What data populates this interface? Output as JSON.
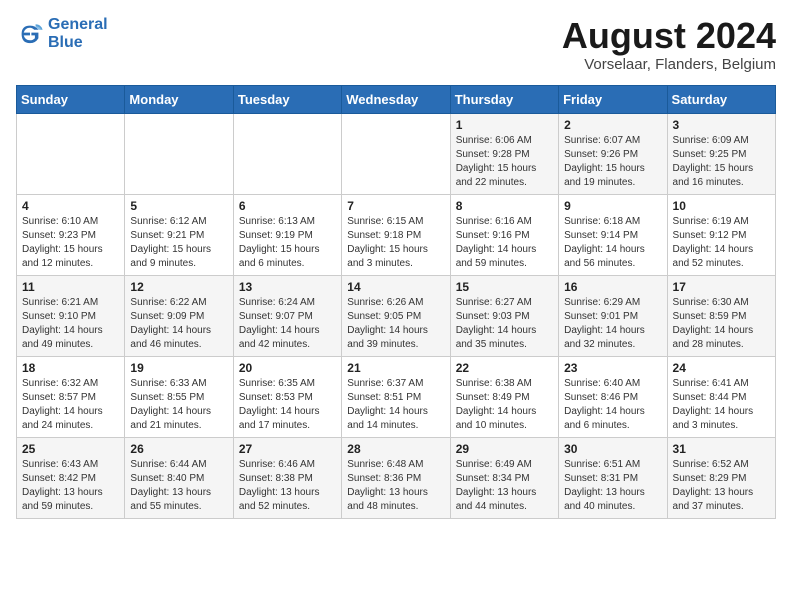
{
  "header": {
    "logo_line1": "General",
    "logo_line2": "Blue",
    "title": "August 2024",
    "subtitle": "Vorselaar, Flanders, Belgium"
  },
  "days_of_week": [
    "Sunday",
    "Monday",
    "Tuesday",
    "Wednesday",
    "Thursday",
    "Friday",
    "Saturday"
  ],
  "weeks": [
    [
      {
        "day": "",
        "info": ""
      },
      {
        "day": "",
        "info": ""
      },
      {
        "day": "",
        "info": ""
      },
      {
        "day": "",
        "info": ""
      },
      {
        "day": "1",
        "info": "Sunrise: 6:06 AM\nSunset: 9:28 PM\nDaylight: 15 hours\nand 22 minutes."
      },
      {
        "day": "2",
        "info": "Sunrise: 6:07 AM\nSunset: 9:26 PM\nDaylight: 15 hours\nand 19 minutes."
      },
      {
        "day": "3",
        "info": "Sunrise: 6:09 AM\nSunset: 9:25 PM\nDaylight: 15 hours\nand 16 minutes."
      }
    ],
    [
      {
        "day": "4",
        "info": "Sunrise: 6:10 AM\nSunset: 9:23 PM\nDaylight: 15 hours\nand 12 minutes."
      },
      {
        "day": "5",
        "info": "Sunrise: 6:12 AM\nSunset: 9:21 PM\nDaylight: 15 hours\nand 9 minutes."
      },
      {
        "day": "6",
        "info": "Sunrise: 6:13 AM\nSunset: 9:19 PM\nDaylight: 15 hours\nand 6 minutes."
      },
      {
        "day": "7",
        "info": "Sunrise: 6:15 AM\nSunset: 9:18 PM\nDaylight: 15 hours\nand 3 minutes."
      },
      {
        "day": "8",
        "info": "Sunrise: 6:16 AM\nSunset: 9:16 PM\nDaylight: 14 hours\nand 59 minutes."
      },
      {
        "day": "9",
        "info": "Sunrise: 6:18 AM\nSunset: 9:14 PM\nDaylight: 14 hours\nand 56 minutes."
      },
      {
        "day": "10",
        "info": "Sunrise: 6:19 AM\nSunset: 9:12 PM\nDaylight: 14 hours\nand 52 minutes."
      }
    ],
    [
      {
        "day": "11",
        "info": "Sunrise: 6:21 AM\nSunset: 9:10 PM\nDaylight: 14 hours\nand 49 minutes."
      },
      {
        "day": "12",
        "info": "Sunrise: 6:22 AM\nSunset: 9:09 PM\nDaylight: 14 hours\nand 46 minutes."
      },
      {
        "day": "13",
        "info": "Sunrise: 6:24 AM\nSunset: 9:07 PM\nDaylight: 14 hours\nand 42 minutes."
      },
      {
        "day": "14",
        "info": "Sunrise: 6:26 AM\nSunset: 9:05 PM\nDaylight: 14 hours\nand 39 minutes."
      },
      {
        "day": "15",
        "info": "Sunrise: 6:27 AM\nSunset: 9:03 PM\nDaylight: 14 hours\nand 35 minutes."
      },
      {
        "day": "16",
        "info": "Sunrise: 6:29 AM\nSunset: 9:01 PM\nDaylight: 14 hours\nand 32 minutes."
      },
      {
        "day": "17",
        "info": "Sunrise: 6:30 AM\nSunset: 8:59 PM\nDaylight: 14 hours\nand 28 minutes."
      }
    ],
    [
      {
        "day": "18",
        "info": "Sunrise: 6:32 AM\nSunset: 8:57 PM\nDaylight: 14 hours\nand 24 minutes."
      },
      {
        "day": "19",
        "info": "Sunrise: 6:33 AM\nSunset: 8:55 PM\nDaylight: 14 hours\nand 21 minutes."
      },
      {
        "day": "20",
        "info": "Sunrise: 6:35 AM\nSunset: 8:53 PM\nDaylight: 14 hours\nand 17 minutes."
      },
      {
        "day": "21",
        "info": "Sunrise: 6:37 AM\nSunset: 8:51 PM\nDaylight: 14 hours\nand 14 minutes."
      },
      {
        "day": "22",
        "info": "Sunrise: 6:38 AM\nSunset: 8:49 PM\nDaylight: 14 hours\nand 10 minutes."
      },
      {
        "day": "23",
        "info": "Sunrise: 6:40 AM\nSunset: 8:46 PM\nDaylight: 14 hours\nand 6 minutes."
      },
      {
        "day": "24",
        "info": "Sunrise: 6:41 AM\nSunset: 8:44 PM\nDaylight: 14 hours\nand 3 minutes."
      }
    ],
    [
      {
        "day": "25",
        "info": "Sunrise: 6:43 AM\nSunset: 8:42 PM\nDaylight: 13 hours\nand 59 minutes."
      },
      {
        "day": "26",
        "info": "Sunrise: 6:44 AM\nSunset: 8:40 PM\nDaylight: 13 hours\nand 55 minutes."
      },
      {
        "day": "27",
        "info": "Sunrise: 6:46 AM\nSunset: 8:38 PM\nDaylight: 13 hours\nand 52 minutes."
      },
      {
        "day": "28",
        "info": "Sunrise: 6:48 AM\nSunset: 8:36 PM\nDaylight: 13 hours\nand 48 minutes."
      },
      {
        "day": "29",
        "info": "Sunrise: 6:49 AM\nSunset: 8:34 PM\nDaylight: 13 hours\nand 44 minutes."
      },
      {
        "day": "30",
        "info": "Sunrise: 6:51 AM\nSunset: 8:31 PM\nDaylight: 13 hours\nand 40 minutes."
      },
      {
        "day": "31",
        "info": "Sunrise: 6:52 AM\nSunset: 8:29 PM\nDaylight: 13 hours\nand 37 minutes."
      }
    ]
  ]
}
